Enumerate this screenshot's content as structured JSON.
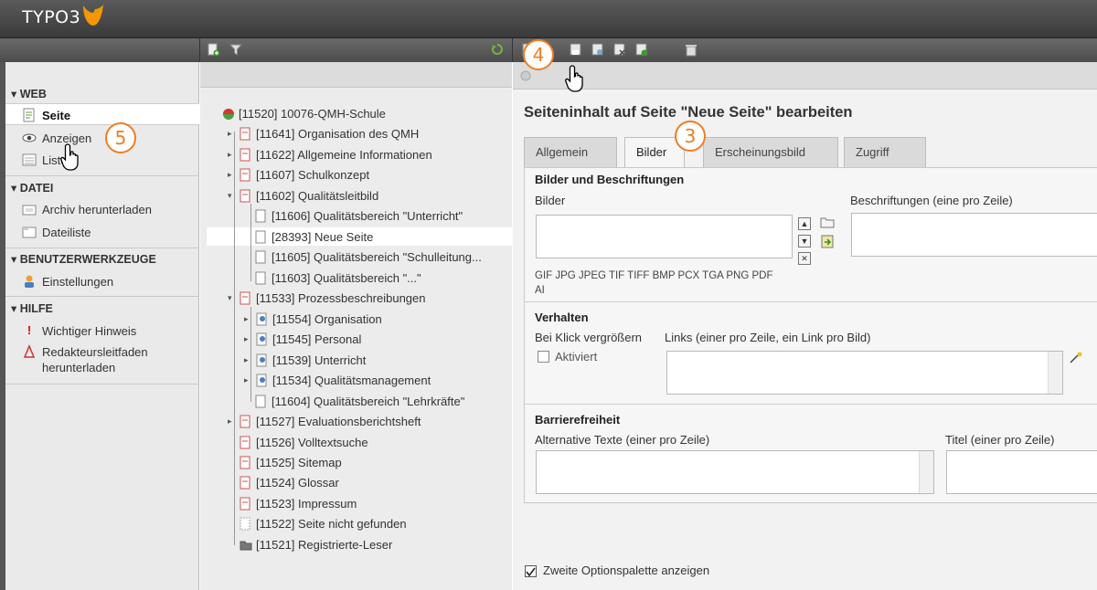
{
  "app": {
    "logo_text": "TYPO3"
  },
  "module_menu": {
    "groups": [
      {
        "title": "▾ WEB",
        "items": [
          {
            "label": "Seite",
            "icon": "page-module-icon"
          },
          {
            "label": "Anzeigen",
            "icon": "eye-icon"
          },
          {
            "label": "Liste",
            "icon": "list-icon"
          }
        ]
      },
      {
        "title": "▾ DATEI",
        "items": [
          {
            "label": "Archiv herunterladen",
            "icon": "archive-icon"
          },
          {
            "label": "Dateiliste",
            "icon": "filelist-icon"
          }
        ]
      },
      {
        "title": "▾ BENUTZERWERKZEUGE",
        "items": [
          {
            "label": "Einstellungen",
            "icon": "user-settings-icon"
          }
        ]
      },
      {
        "title": "▾ HILFE",
        "items": [
          {
            "label": "Wichtiger Hinweis",
            "icon": "exclamation-icon"
          },
          {
            "label": "Redakteursleitfaden herunterladen",
            "icon": "pdf-icon"
          }
        ]
      }
    ]
  },
  "tree": {
    "root": "[11520] 10076-QMH-Schule",
    "nodes": [
      "[11641] Organisation des QMH",
      "[11622] Allgemeine Informationen",
      "[11607] Schulkonzept",
      "[11602] Qualitätsleitbild",
      "[11606] Qualitätsbereich \"Unterricht\"",
      "[28393] Neue Seite",
      "[11605] Qualitätsbereich \"Schulleitung...",
      "[11603] Qualitätsbereich \"...\"",
      "[11533] Prozessbeschreibungen",
      "[11554] Organisation",
      "[11545] Personal",
      "[11539] Unterricht",
      "[11534] Qualitätsmanagement",
      "[11604] Qualitätsbereich \"Lehrkräfte\"",
      "[11527] Evaluationsberichtsheft",
      "[11526] Volltextsuche",
      "[11525] Sitemap",
      "[11524] Glossar",
      "[11523] Impressum",
      "[11522] Seite nicht gefunden",
      "[11521] Registrierte-Leser"
    ]
  },
  "content": {
    "title": "Seiteninhalt auf Seite \"Neue Seite\" bearbeiten",
    "tabs": [
      "Allgemein",
      "Bilder",
      "Erscheinungsbild",
      "Zugriff"
    ],
    "active_tab": "Bilder",
    "sections": {
      "images": {
        "title": "Bilder und Beschriftungen",
        "images_label": "Bilder",
        "captions_label": "Beschriftungen (eine pro Zeile)",
        "file_types": "GIF JPG JPEG TIF TIFF BMP PCX TGA PNG PDF",
        "file_types_2": "AI"
      },
      "behavior": {
        "title": "Verhalten",
        "click_enlarge": "Bei Klick vergrößern",
        "activated": "Aktiviert",
        "links_label": "Links (einer pro Zeile, ein Link pro Bild)"
      },
      "accessibility": {
        "title": "Barrierefreiheit",
        "alt_label": "Alternative Texte (einer pro Zeile)",
        "title_label": "Titel (einer pro Zeile)"
      }
    },
    "second_palette": "Zweite Optionspalette anzeigen"
  },
  "annotations": {
    "badge_tabs": "3",
    "badge_toolbar": "4",
    "badge_view": "5"
  }
}
